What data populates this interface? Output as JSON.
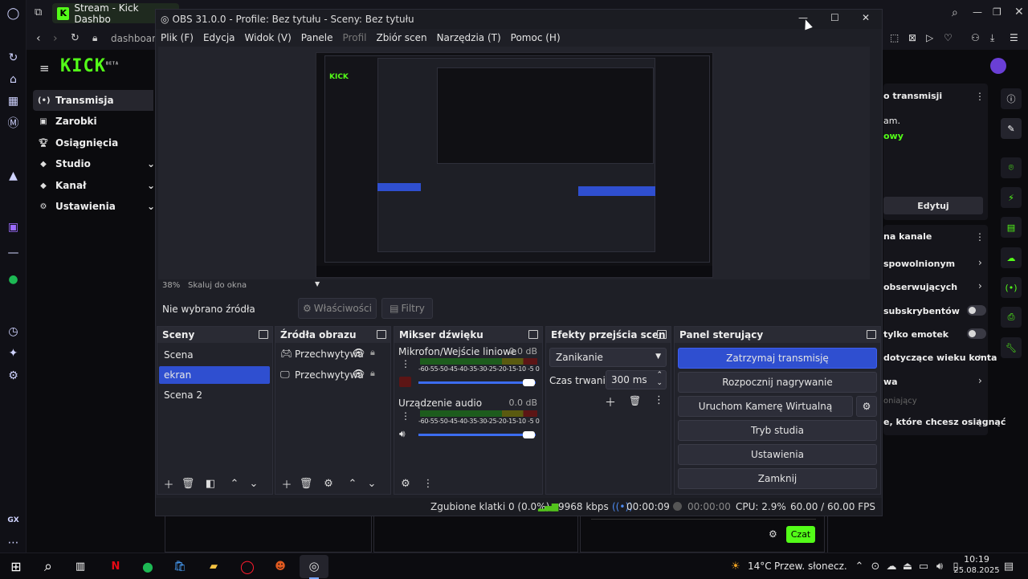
{
  "browser": {
    "tab_title": "Stream - Kick Dashbo",
    "address": "dashboard",
    "gx_label": "GX"
  },
  "kick": {
    "logo": "KICK",
    "logo_sup": "BETA",
    "nav": [
      {
        "label": "Transmisja",
        "icon": "broadcast-icon"
      },
      {
        "label": "Zarobki",
        "icon": "wallet-icon"
      },
      {
        "label": "Osiągnięcia",
        "icon": "trophy-icon"
      },
      {
        "label": "Studio",
        "icon": "studio-icon"
      },
      {
        "label": "Kanał",
        "icon": "channel-icon"
      },
      {
        "label": "Ustawienia",
        "icon": "settings-icon"
      }
    ],
    "right_panel": {
      "header_info": "o transmisji",
      "line1": "am.",
      "line2": "owy",
      "edit_label": "Edytuj",
      "header_channel": "na kanale",
      "items": [
        "spowolnionym",
        "obserwujących",
        "subskrybentów",
        "tylko emotek",
        "dotyczące wieku konta",
        "wa",
        "oniający",
        "e, które chcesz osiągnąć"
      ]
    },
    "chat_button": "Czat"
  },
  "obs": {
    "title": "OBS 31.0.0 - Profile: Bez tytułu - Sceny: Bez tytułu",
    "menu": [
      "Plik (F)",
      "Edycja",
      "Widok (V)",
      "Panele",
      "Profil",
      "Zbiór scen",
      "Narzędzia (T)",
      "Pomoc (H)"
    ],
    "zoom": "38%",
    "scale_mode": "Skaluj do okna",
    "no_source": "Nie wybrano źródła",
    "properties": "Właściwości",
    "filters": "Filtry",
    "scenes": {
      "title": "Sceny",
      "items": [
        "Scena",
        "ekran",
        "Scena 2"
      ]
    },
    "sources": {
      "title": "Źródła obrazu",
      "items": [
        "Przechwytywa",
        "Przechwytywa"
      ]
    },
    "mixer": {
      "title": "Mikser dźwięku",
      "channels": [
        {
          "name": "Mikrofon/Wejście liniowe",
          "db": "0.0 dB"
        },
        {
          "name": "Urządzenie audio",
          "db": "0.0 dB"
        }
      ],
      "scale": "-60-55-50-45-40-35-30-25-20-15-10 -5 0"
    },
    "transitions": {
      "title": "Efekty przejścia scen",
      "selected": "Zanikanie",
      "duration_label": "Czas trwania",
      "duration_value": "300 ms"
    },
    "controls": {
      "title": "Panel sterujący",
      "buttons": [
        "Zatrzymaj transmisję",
        "Rozpocznij nagrywanie",
        "Uruchom Kamerę Wirtualną",
        "Tryb studia",
        "Ustawienia",
        "Zamknij"
      ]
    },
    "status": {
      "dropped": "Zgubione klatki 0 (0.0%)",
      "kbps": "9968 kbps",
      "stream_time": "00:00:09",
      "rec_time": "00:00:00",
      "cpu": "CPU: 2.9%",
      "fps": "60.00 / 60.00 FPS"
    }
  },
  "taskbar": {
    "weather_temp": "14°C",
    "weather_text": "Przew. słonecz.",
    "time": "10:19",
    "date": "25.08.2025"
  },
  "colors": {
    "kick_green": "#53fc18",
    "obs_selected": "#2f4fd0",
    "stop_stream": "#2f4fd0"
  }
}
